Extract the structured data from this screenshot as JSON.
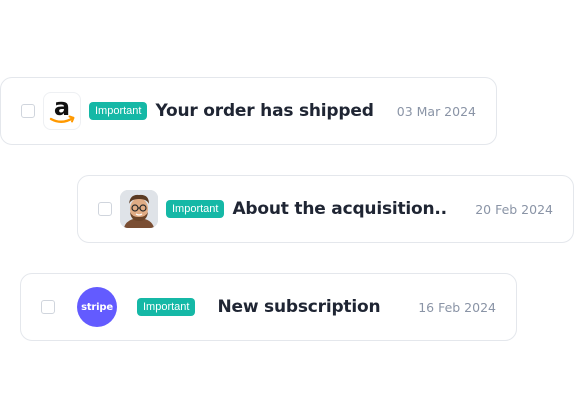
{
  "messages": [
    {
      "badge": "Important",
      "title": "Your order has shipped",
      "date": "03 Mar 2024",
      "avatar_icon": "amazon-logo-icon"
    },
    {
      "badge": "Important",
      "title": "About the acquisition..",
      "date": "20 Feb 2024",
      "avatar_icon": "person-avatar-icon"
    },
    {
      "badge": "Important",
      "title": "New subscription",
      "date": "16 Feb 2024",
      "avatar_icon": "stripe-logo-icon",
      "avatar_text": "stripe"
    }
  ],
  "colors": {
    "badge_bg": "#15b8a6",
    "stripe_purple": "#635bff",
    "amazon_orange": "#ff9900",
    "title_text": "#1f2533",
    "date_text": "#8a94a6"
  }
}
